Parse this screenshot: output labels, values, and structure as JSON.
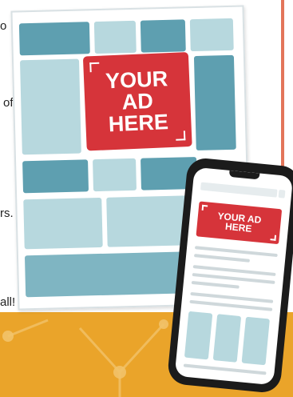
{
  "fragments": [
    "o",
    "of",
    "rs.",
    "all!"
  ],
  "ad_main": {
    "lines": [
      "YOUR",
      "AD",
      "HERE"
    ]
  },
  "ad_phone": {
    "lines": [
      "YOUR AD",
      "HERE"
    ]
  },
  "colors": {
    "ad_red": "#d6343a",
    "block_dark": "#5e9fb0",
    "block_light": "#b7d8de",
    "band_orange": "#eaa42a",
    "edge_orange": "#e3755a"
  }
}
